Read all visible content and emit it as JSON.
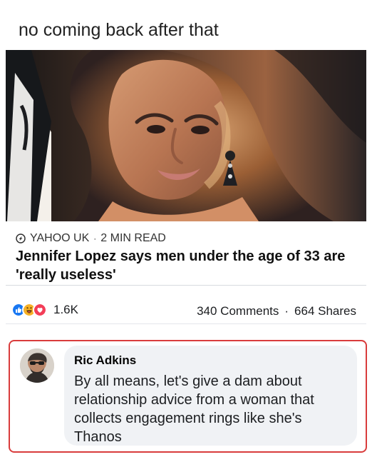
{
  "caption": "no coming back after that",
  "link_card": {
    "source": "YAHOO UK",
    "separator": "·",
    "read_time": "2 MIN READ",
    "headline": "Jennifer Lopez says men under the age of 33 are 'really useless'"
  },
  "engagement": {
    "reactions": [
      "like",
      "haha",
      "love"
    ],
    "reaction_count": "1.6K",
    "comments": "340 Comments",
    "separator": "·",
    "shares": "664 Shares"
  },
  "comment": {
    "author": "Ric Adkins",
    "text": "By all means,  let's give a dam   about\nrelationship advice from a woman that\ncollects engagement rings like she's\nThanos"
  },
  "colors": {
    "highlight_border": "#d93c3c",
    "bubble_background": "#f0f2f5",
    "like_reaction": "#1877f2",
    "haha_reaction": "#f7b125",
    "love_reaction": "#f33e58"
  },
  "icons": {
    "source": "yahoo-source-icon",
    "like": "like-reaction-icon",
    "haha": "haha-reaction-icon",
    "love": "love-reaction-icon"
  }
}
